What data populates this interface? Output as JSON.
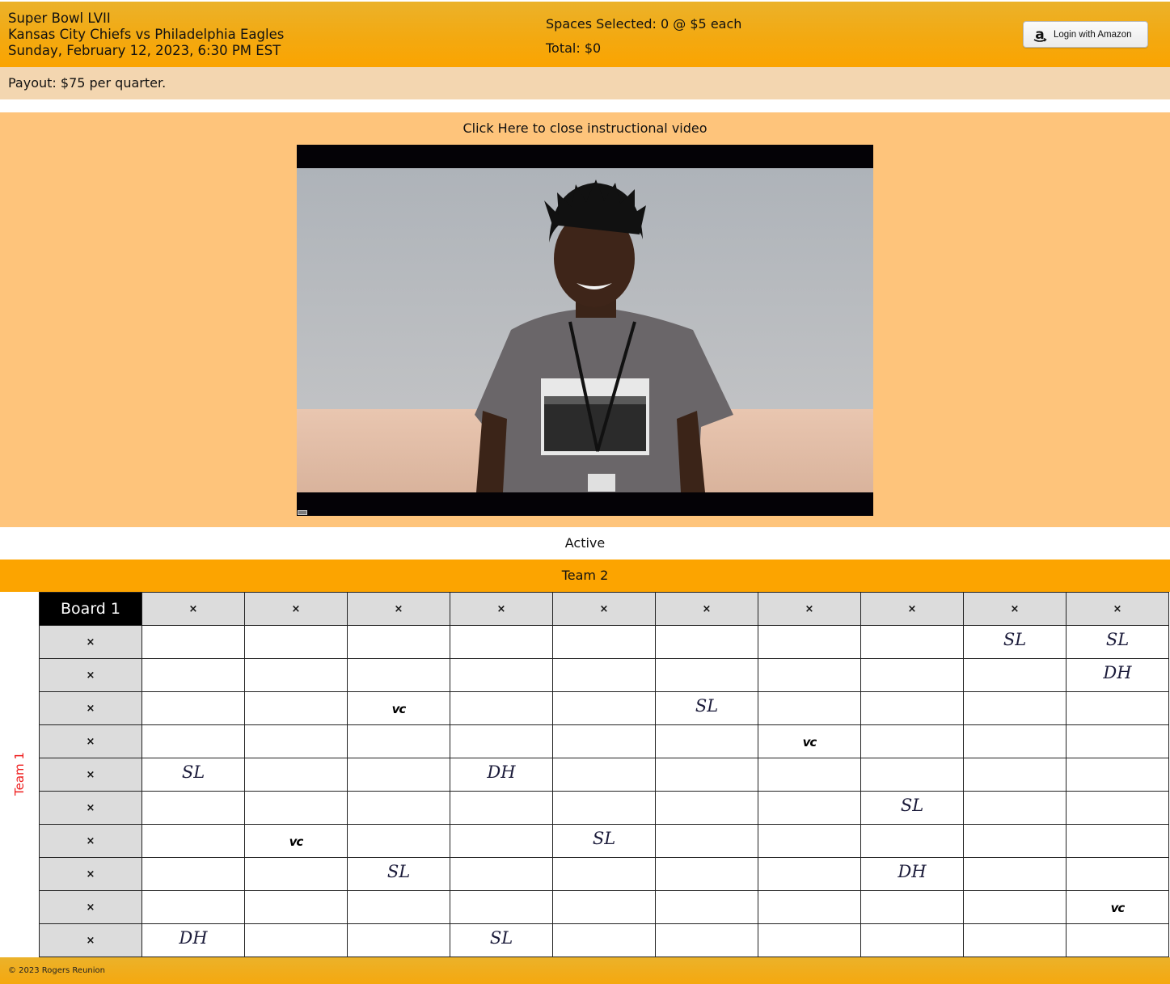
{
  "header": {
    "event_title": "Super Bowl LVII",
    "matchup": "Kansas City Chiefs vs Philadelphia Eagles",
    "datetime": "Sunday, February 12, 2023, 6:30 PM EST",
    "spaces_selected": "Spaces Selected: 0 @ $5 each",
    "total": "Total: $0",
    "login_button": "Login with Amazon",
    "login_icon": "amazon-logo-icon"
  },
  "payout": "Payout: $75 per quarter.",
  "video": {
    "close_link": "Click Here to close instructional video"
  },
  "status": "Active",
  "board": {
    "title": "Board 1",
    "team_top": "Team 2",
    "team_side": "Team 1",
    "placeholder": "×",
    "column_headers": [
      "×",
      "×",
      "×",
      "×",
      "×",
      "×",
      "×",
      "×",
      "×",
      "×"
    ],
    "row_headers": [
      "×",
      "×",
      "×",
      "×",
      "×",
      "×",
      "×",
      "×",
      "×",
      "×"
    ],
    "cells": [
      [
        "",
        "",
        "",
        "",
        "",
        "",
        "",
        "",
        "SL",
        "SL"
      ],
      [
        "",
        "",
        "",
        "",
        "",
        "",
        "",
        "",
        "",
        "DH"
      ],
      [
        "",
        "",
        "vc",
        "",
        "",
        "SL",
        "",
        "",
        "",
        ""
      ],
      [
        "",
        "",
        "",
        "",
        "",
        "",
        "vc",
        "",
        "",
        ""
      ],
      [
        "SL",
        "",
        "",
        "DH",
        "",
        "",
        "",
        "",
        "",
        ""
      ],
      [
        "",
        "",
        "",
        "",
        "",
        "",
        "",
        "SL",
        "",
        ""
      ],
      [
        "",
        "vc",
        "",
        "",
        "SL",
        "",
        "",
        "",
        "",
        ""
      ],
      [
        "",
        "",
        "SL",
        "",
        "",
        "",
        "",
        "DH",
        "",
        ""
      ],
      [
        "",
        "",
        "",
        "",
        "",
        "",
        "",
        "",
        "",
        "vc"
      ],
      [
        "DH",
        "",
        "",
        "SL",
        "",
        "",
        "",
        "",
        "",
        ""
      ]
    ]
  },
  "footer": "© 2023 Rogers Reunion",
  "colors": {
    "header": "#f3a911",
    "payout_bar": "#f3d6b0",
    "video_panel": "#fec47b",
    "team_bar": "#fca400",
    "team_side_text": "#ee1c1c",
    "board_title_bg": "#000000",
    "header_cell_bg": "#dcdcdc"
  }
}
